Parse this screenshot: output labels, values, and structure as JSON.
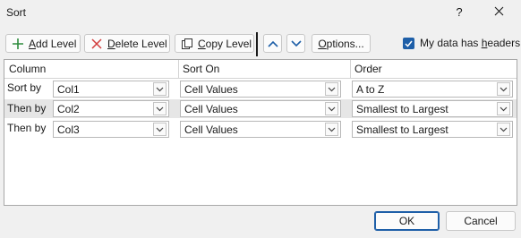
{
  "window": {
    "title": "Sort",
    "help_label": "?",
    "close_label": "✕"
  },
  "toolbar": {
    "add_level": {
      "underline": "A",
      "rest": "dd Level",
      "icon": "plus-icon"
    },
    "delete_level": {
      "underline": "D",
      "rest": "elete Level",
      "icon": "x-icon"
    },
    "copy_level": {
      "underline": "C",
      "rest": "opy Level",
      "icon": "copy-icon"
    },
    "move_up_icon": "chevron-up-icon",
    "move_down_icon": "chevron-down-icon",
    "options": {
      "underline": "O",
      "rest": "ptions..."
    },
    "headers_checkbox": {
      "checked": true,
      "label_pre": "My data has ",
      "underline": "h",
      "label_post": "eaders"
    }
  },
  "grid": {
    "headers": {
      "column": "Column",
      "sort_on": "Sort On",
      "order": "Order"
    },
    "rows": [
      {
        "label": "Sort by",
        "column": "Col1",
        "sort_on": "Cell Values",
        "order": "A to Z"
      },
      {
        "label": "Then by",
        "column": "Col2",
        "sort_on": "Cell Values",
        "order": "Smallest to Largest",
        "selected": true
      },
      {
        "label": "Then by",
        "column": "Col3",
        "sort_on": "Cell Values",
        "order": "Smallest to Largest"
      }
    ]
  },
  "footer": {
    "ok_label": "OK",
    "cancel_label": "Cancel"
  },
  "colors": {
    "accent": "#1e5fa8",
    "add_icon": "#2e8b3d",
    "delete_icon": "#d23c3c"
  }
}
